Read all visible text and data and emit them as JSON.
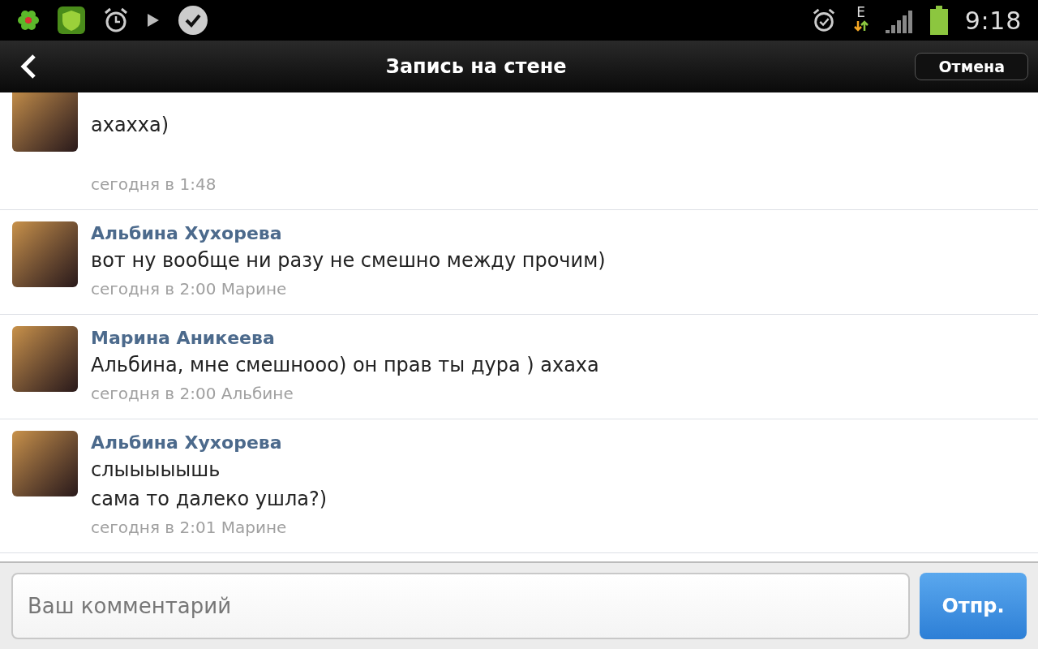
{
  "status_bar": {
    "network": "E",
    "time": "9:18"
  },
  "title_bar": {
    "title": "Запись на стене",
    "cancel": "Отмена"
  },
  "comments": [
    {
      "message": [
        "ахахха)"
      ],
      "time": "сегодня в 1:48"
    },
    {
      "author": "Альбина Хухорева",
      "message": [
        "вот ну вообще ни разу не смешно между прочим)"
      ],
      "time": "сегодня в 2:00 Марине"
    },
    {
      "author": "Марина Аникеева",
      "message": [
        "Альбина, мне смешнооо) он прав ты дура ) ахаха"
      ],
      "time": "сегодня в 2:00 Альбине"
    },
    {
      "author": "Альбина Хухорева",
      "message": [
        "слыыыыышь",
        "сама то далеко ушла?)"
      ],
      "time": "сегодня в 2:01 Марине"
    }
  ],
  "composer": {
    "placeholder": "Ваш комментарий",
    "send": "Отпр."
  }
}
